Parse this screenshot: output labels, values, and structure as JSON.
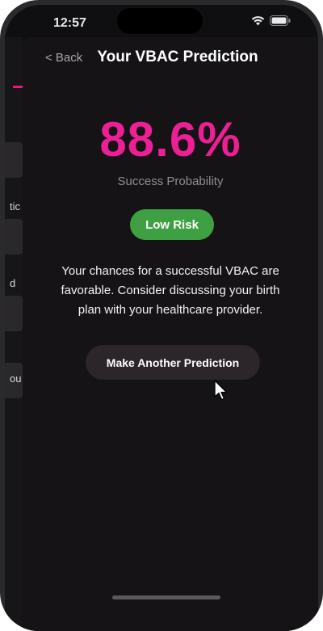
{
  "status_bar": {
    "time": "12:57"
  },
  "behind_screen": {
    "labels": [
      "tic",
      "d",
      "ou"
    ]
  },
  "nav": {
    "back_label": "< Back",
    "title": "Your VBAC Prediction"
  },
  "result": {
    "percentage": "88.6%",
    "subtitle": "Success Probability",
    "risk_label": "Low Risk",
    "message": "Your chances for a successful VBAC are favorable. Consider discussing your birth plan with your healthcare provider."
  },
  "actions": {
    "make_another_label": "Make Another Prediction"
  },
  "colors": {
    "accent": "#ee1f94",
    "risk_low": "#3fa043",
    "background": "#151316"
  }
}
